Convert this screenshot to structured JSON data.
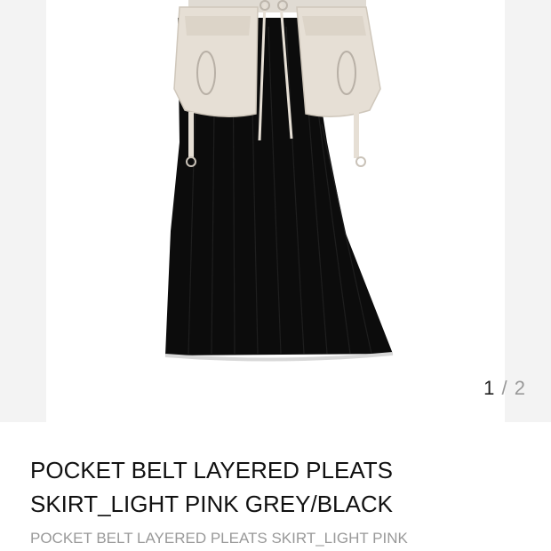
{
  "gallery": {
    "current_index": "1",
    "separator": "/",
    "total": "2"
  },
  "product": {
    "title": "POCKET BELT LAYERED PLEATS SKIRT_LIGHT PINK GREY/BLACK",
    "subtitle": "POCKET BELT LAYERED PLEATS SKIRT_LIGHT PINK"
  },
  "colors": {
    "skirt": "#0c0c0c",
    "belt": "#e6dfd5",
    "page_bg": "#f3f3f3"
  }
}
